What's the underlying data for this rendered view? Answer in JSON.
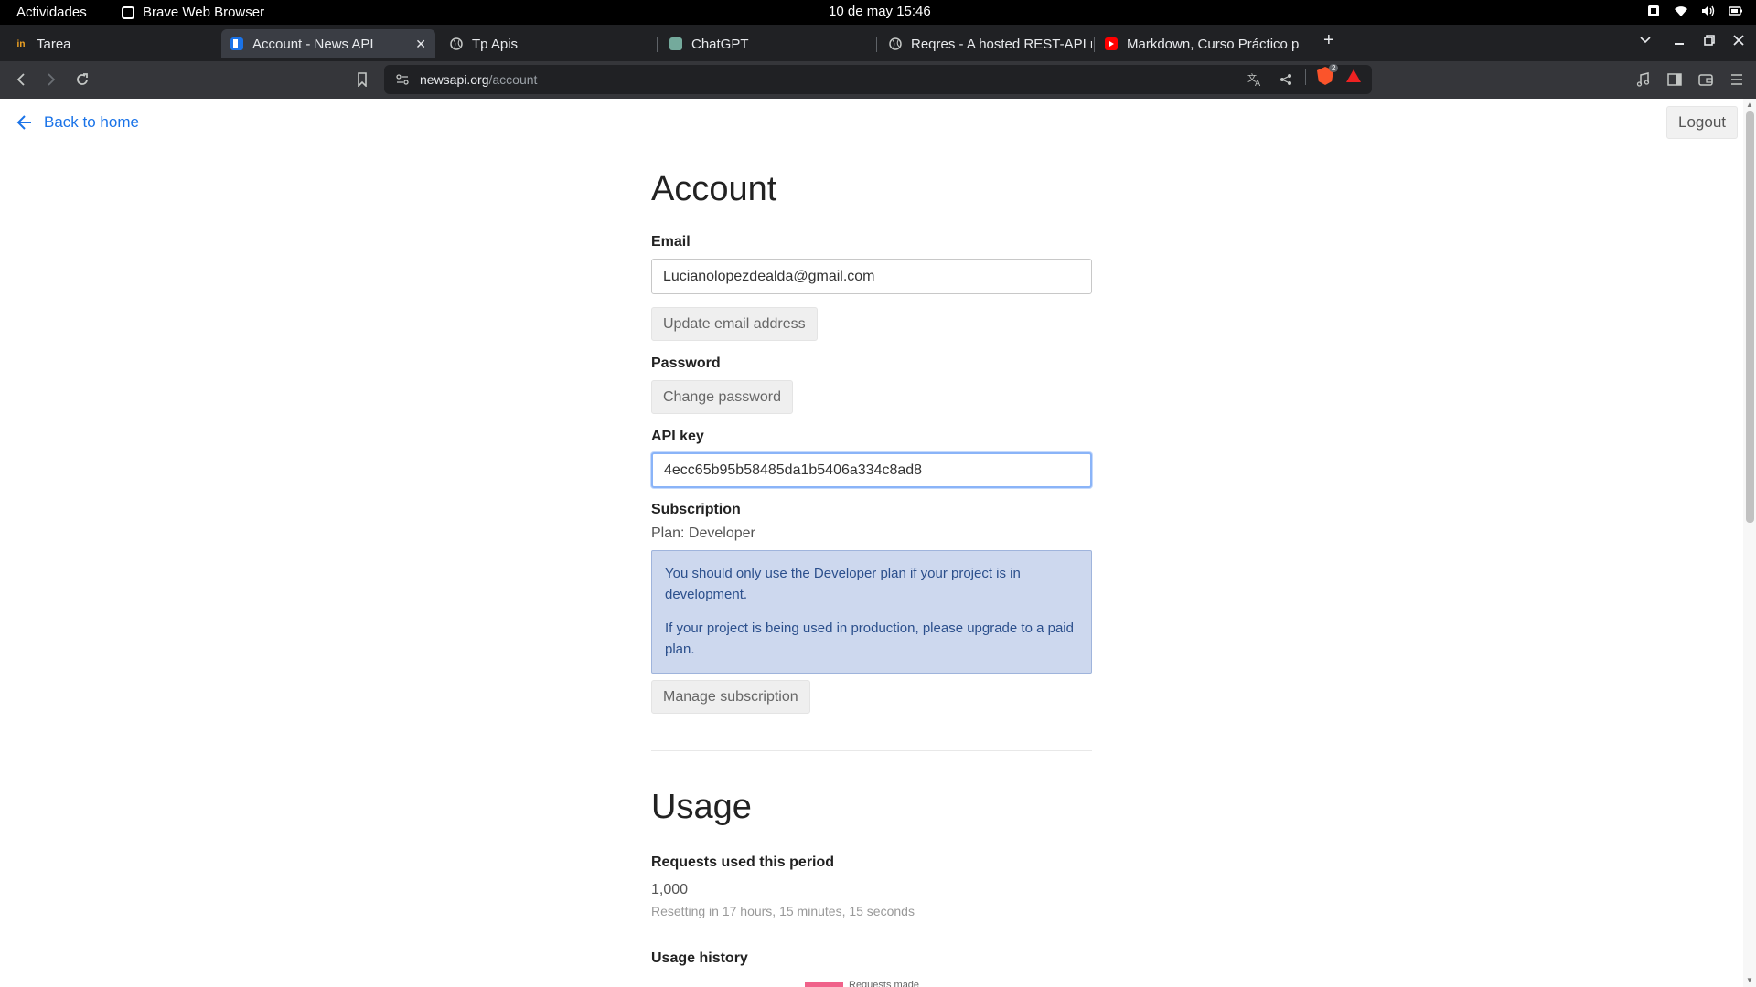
{
  "os_bar": {
    "activities": "Actividades",
    "app_name": "Brave Web Browser",
    "clock": "10 de may  15:46"
  },
  "tabs": [
    {
      "label": "Tarea",
      "favicon": "in",
      "favicon_color": "#f5a623"
    },
    {
      "label": "Account - News API",
      "active": true
    },
    {
      "label": "Tp Apis"
    },
    {
      "label": "ChatGPT"
    },
    {
      "label": "Reqres - A hosted REST-API r"
    },
    {
      "label": "Markdown, Curso Práctico p"
    }
  ],
  "address_bar": {
    "domain": "newsapi.org",
    "path": "/account"
  },
  "brave_shield_count": "2",
  "page": {
    "back_link": "Back to home",
    "logout": "Logout",
    "account": {
      "title": "Account",
      "email_label": "Email",
      "email_value": "Lucianolopezdealda@gmail.com",
      "update_email_button": "Update email address",
      "password_label": "Password",
      "change_password_button": "Change password",
      "api_key_label": "API key",
      "api_key_value": "4ecc65b95b58485da1b5406a334c8ad8",
      "subscription_label": "Subscription",
      "plan_text": "Plan: Developer",
      "notice_line1": "You should only use the Developer plan if your project is in development.",
      "notice_line2": "If your project is being used in production, please upgrade to a paid plan.",
      "manage_subscription_button": "Manage subscription"
    },
    "usage": {
      "title": "Usage",
      "requests_label": "Requests used this period",
      "requests_value": "1,000",
      "resetting_text": "Resetting in 17 hours, 15 minutes, 15 seconds",
      "history_label": "Usage history",
      "legend_label": "Requests made",
      "legend_color": "#f0628a"
    }
  }
}
